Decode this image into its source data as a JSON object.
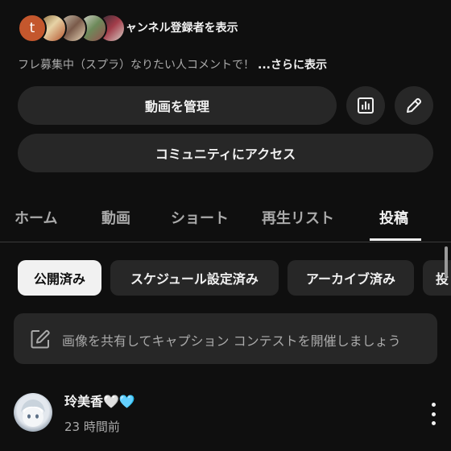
{
  "channel": {
    "avatar_letter": "t",
    "subscribers_link": "チャンネル登録者を表示",
    "description": "フレ募集中（スプラ）なりたい人コメントで！",
    "more_label": "...さらに表示"
  },
  "actions": {
    "manage_videos": "動画を管理",
    "community_access": "コミュニティにアクセス",
    "analytics_icon": "analytics-icon",
    "edit_icon": "pencil-icon"
  },
  "tabs": [
    {
      "label": "ホーム"
    },
    {
      "label": "動画"
    },
    {
      "label": "ショート"
    },
    {
      "label": "再生リスト"
    },
    {
      "label": "投稿",
      "active": true
    }
  ],
  "chips": [
    {
      "label": "公開済み",
      "selected": true
    },
    {
      "label": "スケジュール設定済み"
    },
    {
      "label": "アーカイブ済み"
    },
    {
      "label": "投"
    }
  ],
  "create_post": {
    "placeholder": "画像を共有してキャプション コンテストを開催しましょう",
    "icon": "edit-box-icon"
  },
  "post": {
    "author": "玲美香🤍🩵",
    "time": "23 時間前",
    "menu_icon": "more-vert-icon"
  },
  "colors": {
    "background": "#0f0f0f",
    "surface": "#272727",
    "text": "#f1f1f1",
    "secondary_text": "#aaaaaa",
    "avatar_t": "#c4572d"
  }
}
